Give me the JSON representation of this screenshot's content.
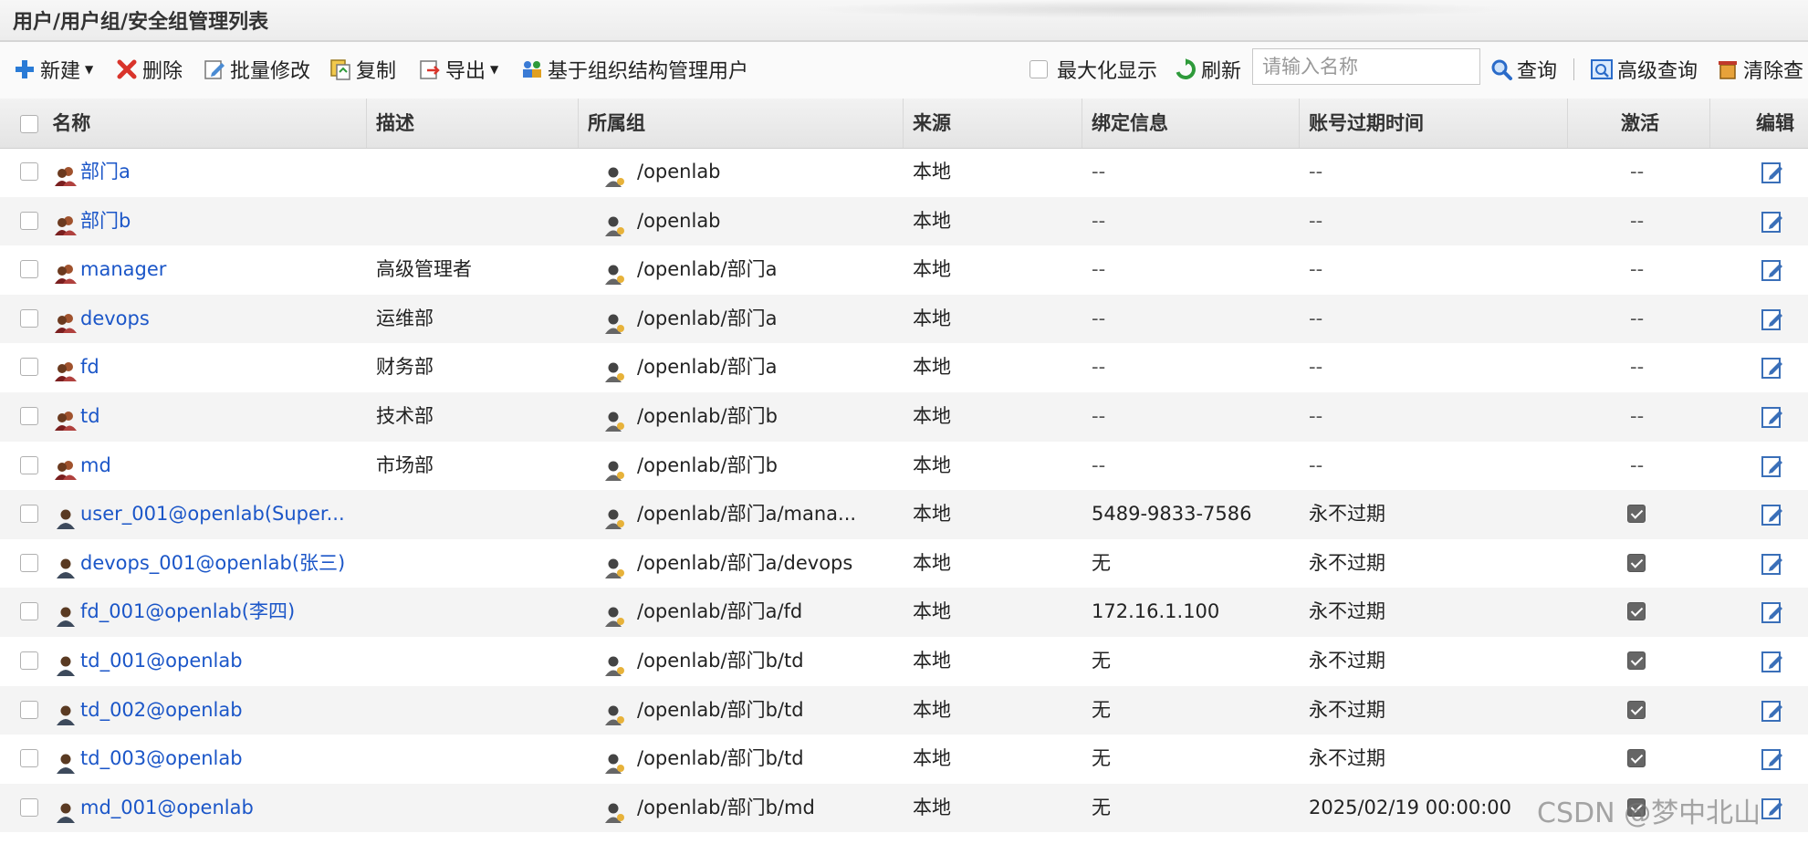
{
  "page_title": "用户/用户组/安全组管理列表",
  "toolbar": {
    "new_label": "新建",
    "delete_label": "删除",
    "batch_edit_label": "批量修改",
    "copy_label": "复制",
    "export_label": "导出",
    "org_manage_label": "基于组织结构管理用户",
    "maximize_label": "最大化显示",
    "refresh_label": "刷新",
    "search_placeholder": "请输入名称",
    "query_label": "查询",
    "advanced_query_label": "高级查询",
    "clear_label": "清除查"
  },
  "columns": {
    "name": "名称",
    "desc": "描述",
    "group": "所属组",
    "source": "来源",
    "binding": "绑定信息",
    "expire": "账号过期时间",
    "active": "激活",
    "edit": "编辑"
  },
  "rows": [
    {
      "type": "group",
      "name": "部门a",
      "desc": "",
      "group": "/openlab",
      "source": "本地",
      "binding": "--",
      "expire": "--",
      "active": "--"
    },
    {
      "type": "group",
      "name": "部门b",
      "desc": "",
      "group": "/openlab",
      "source": "本地",
      "binding": "--",
      "expire": "--",
      "active": "--"
    },
    {
      "type": "group",
      "name": "manager",
      "desc": "高级管理者",
      "group": "/openlab/部门a",
      "source": "本地",
      "binding": "--",
      "expire": "--",
      "active": "--"
    },
    {
      "type": "group",
      "name": "devops",
      "desc": "运维部",
      "group": "/openlab/部门a",
      "source": "本地",
      "binding": "--",
      "expire": "--",
      "active": "--"
    },
    {
      "type": "group",
      "name": "fd",
      "desc": "财务部",
      "group": "/openlab/部门a",
      "source": "本地",
      "binding": "--",
      "expire": "--",
      "active": "--"
    },
    {
      "type": "group",
      "name": "td",
      "desc": "技术部",
      "group": "/openlab/部门b",
      "source": "本地",
      "binding": "--",
      "expire": "--",
      "active": "--"
    },
    {
      "type": "group",
      "name": "md",
      "desc": "市场部",
      "group": "/openlab/部门b",
      "source": "本地",
      "binding": "--",
      "expire": "--",
      "active": "--"
    },
    {
      "type": "user",
      "name": "user_001@openlab(Super...",
      "desc": "",
      "group": "/openlab/部门a/mana...",
      "source": "本地",
      "binding": "5489-9833-7586",
      "expire": "永不过期",
      "active": "checked"
    },
    {
      "type": "user",
      "name": "devops_001@openlab(张三)",
      "desc": "",
      "group": "/openlab/部门a/devops",
      "source": "本地",
      "binding": "无",
      "expire": "永不过期",
      "active": "checked"
    },
    {
      "type": "user",
      "name": "fd_001@openlab(李四)",
      "desc": "",
      "group": "/openlab/部门a/fd",
      "source": "本地",
      "binding": "172.16.1.100",
      "expire": "永不过期",
      "active": "checked"
    },
    {
      "type": "user",
      "name": "td_001@openlab",
      "desc": "",
      "group": "/openlab/部门b/td",
      "source": "本地",
      "binding": "无",
      "expire": "永不过期",
      "active": "checked"
    },
    {
      "type": "user",
      "name": "td_002@openlab",
      "desc": "",
      "group": "/openlab/部门b/td",
      "source": "本地",
      "binding": "无",
      "expire": "永不过期",
      "active": "checked"
    },
    {
      "type": "user",
      "name": "td_003@openlab",
      "desc": "",
      "group": "/openlab/部门b/td",
      "source": "本地",
      "binding": "无",
      "expire": "永不过期",
      "active": "checked"
    },
    {
      "type": "user",
      "name": "md_001@openlab",
      "desc": "",
      "group": "/openlab/部门b/md",
      "source": "本地",
      "binding": "无",
      "expire": "2025/02/19 00:00:00",
      "active": "checked"
    }
  ],
  "watermark": "CSDN @梦中北山",
  "colors": {
    "link": "#1b56c8",
    "header_bg": "#e8e8e8",
    "alt_row": "#f4f4f4"
  }
}
